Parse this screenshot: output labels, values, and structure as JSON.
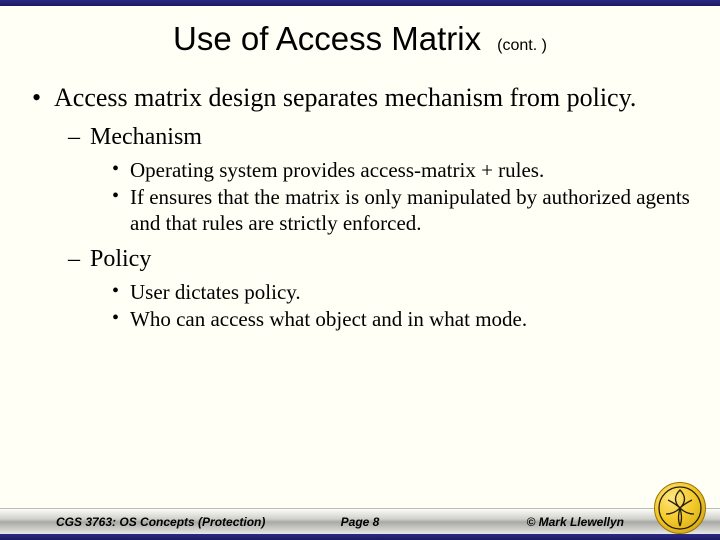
{
  "title": "Use of Access Matrix",
  "title_cont": "(cont. )",
  "bullets": {
    "b1": "Access matrix design separates mechanism from policy.",
    "b1a": "Mechanism",
    "b1a_i": "Operating system provides access-matrix + rules.",
    "b1a_ii": "If ensures that the matrix is only manipulated by authorized agents and that rules are strictly enforced.",
    "b1b": "Policy",
    "b1b_i": "User dictates policy.",
    "b1b_ii": "Who can access what object and in what mode."
  },
  "footer": {
    "left": "CGS 3763: OS Concepts (Protection)",
    "center": "Page 8",
    "right": "© Mark Llewellyn"
  },
  "logo_name": "ucf-pegasus"
}
